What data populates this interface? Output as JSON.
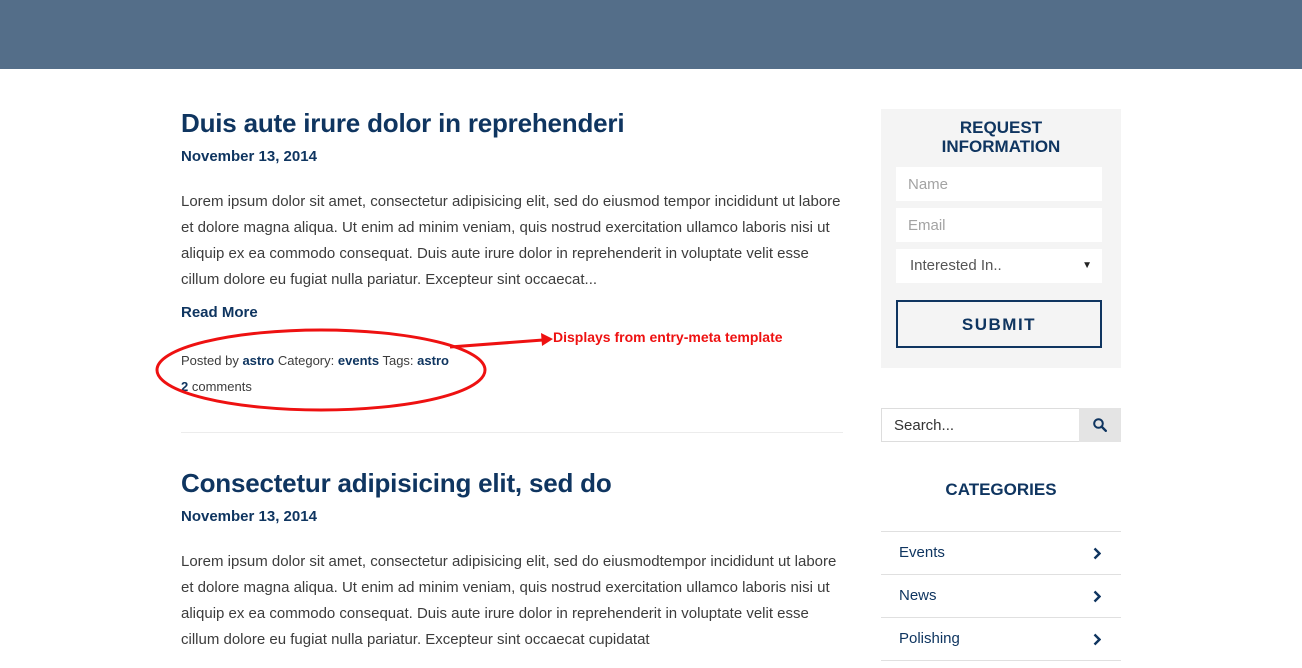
{
  "posts": [
    {
      "title": "Duis aute irure dolor in reprehenderi",
      "date": "November 13, 2014",
      "excerpt": "Lorem ipsum dolor sit amet, consectetur adipisicing elit, sed do eiusmod tempor incididunt ut labore et dolore magna aliqua. Ut enim ad minim veniam, quis nostrud exercitation ullamco laboris nisi ut aliquip ex ea commodo consequat. Duis aute irure dolor in reprehenderit in voluptate velit esse cillum dolore eu fugiat nulla pariatur. Excepteur sint occaecat...",
      "read_more": "Read More",
      "meta": {
        "posted_by_label": "Posted by",
        "author": "astro",
        "category_label": "Category:",
        "category": "events",
        "tags_label": "Tags:",
        "tag": "astro",
        "comments_count": "2",
        "comments_label": "comments"
      }
    },
    {
      "title": "Consectetur adipisicing elit, sed do",
      "date": "November 13, 2014",
      "excerpt": "Lorem ipsum dolor sit amet, consectetur adipisicing elit, sed do eiusmodtempor incididunt ut labore et dolore magna aliqua. Ut enim ad minim veniam, quis nostrud exercitation ullamco laboris nisi ut aliquip ex ea commodo consequat. Duis aute irure dolor in reprehenderit in voluptate velit esse cillum dolore eu fugiat nulla pariatur. Excepteur sint occaecat cupidatat"
    }
  ],
  "annotation": {
    "text": "Displays from entry-meta template",
    "color": "#ee1111"
  },
  "request_form": {
    "heading_line1": "REQUEST",
    "heading_line2": "INFORMATION",
    "name_placeholder": "Name",
    "email_placeholder": "Email",
    "interest_selected": "Interested In..",
    "submit_label": "SUBMIT"
  },
  "search": {
    "placeholder": "Search..."
  },
  "categories": {
    "heading": "CATEGORIES",
    "items": [
      {
        "label": "Events"
      },
      {
        "label": "News"
      },
      {
        "label": "Polishing"
      }
    ]
  },
  "colors": {
    "topbar": "#546e89",
    "brand_navy": "#0f3560",
    "sidebar_bg": "#f4f4f4"
  },
  "icons": {
    "search": "search-icon",
    "chevron": "chevron-right-icon",
    "caret": "caret-down-icon"
  }
}
